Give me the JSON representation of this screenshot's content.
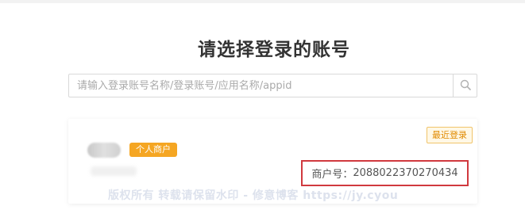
{
  "header": {
    "title": "请选择登录的账号"
  },
  "search": {
    "placeholder": "请输入登录账号名称/登录账号/应用名称/appid",
    "icon": "search-icon"
  },
  "account_card": {
    "type_badge": "个人商户",
    "recent_badge": "最近登录",
    "merchant_label": "商户号：",
    "merchant_id": "2088022370270434",
    "watermark": "版权所有 转载请保留水印 - 修意博客 https://jy.cyou"
  },
  "colors": {
    "badge_orange": "#f5a623",
    "highlight_red": "#d0393e",
    "recent_text": "#e08a00"
  }
}
